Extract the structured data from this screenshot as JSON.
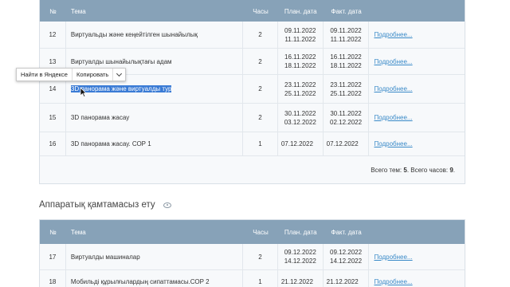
{
  "headers": {
    "num": "№",
    "theme": "Тема",
    "hours": "Часы",
    "plan": "План. дата",
    "fact": "Факт. дата"
  },
  "link_label": "Подробнее...",
  "table1": [
    {
      "num": "12",
      "theme": "Виртуальды және кеңейтілген шынайылық",
      "hours": "2",
      "plan1": "09.11.2022",
      "plan2": "11.11.2022",
      "fact1": "09.11.2022",
      "fact2": "11.11.2022"
    },
    {
      "num": "13",
      "theme": "Виртуалды шынайылықтағы адам",
      "hours": "2",
      "plan1": "16.11.2022",
      "plan2": "18.11.2022",
      "fact1": "16.11.2022",
      "fact2": "18.11.2022"
    },
    {
      "num": "14",
      "theme": "3D панорама және виртуалды тур",
      "hours": "2",
      "plan1": "23.11.2022",
      "plan2": "25.11.2022",
      "fact1": "23.11.2022",
      "fact2": "25.11.2022"
    },
    {
      "num": "15",
      "theme": "3D панорама жасау",
      "hours": "2",
      "plan1": "30.11.2022",
      "plan2": "03.12.2022",
      "fact1": "30.11.2022",
      "fact2": "02.12.2022"
    },
    {
      "num": "16",
      "theme": "3D панорама жасау. СОР 1",
      "hours": "1",
      "plan1": "07.12.2022",
      "plan2": "",
      "fact1": "07.12.2022",
      "fact2": ""
    }
  ],
  "summary": {
    "prefix": "Всего тем: ",
    "themes": "5",
    "middle": ". Всего часов: ",
    "hours": "9",
    "suffix": "."
  },
  "section2_title": "Аппаратық қамтамасыз ету",
  "table2": [
    {
      "num": "17",
      "theme": "Виртуалды машиналар",
      "hours": "2",
      "plan1": "09.12.2022",
      "plan2": "14.12.2022",
      "fact1": "09.12.2022",
      "fact2": "14.12.2022"
    },
    {
      "num": "18",
      "theme": "Мобильді құрылғылардың сипаттамасы.СОР 2",
      "hours": "1",
      "plan1": "21.12.2022",
      "plan2": "",
      "fact1": "21.12.2022",
      "fact2": ""
    }
  ],
  "context_menu": {
    "find": "Найти в Яндексе",
    "copy": "Копировать"
  }
}
